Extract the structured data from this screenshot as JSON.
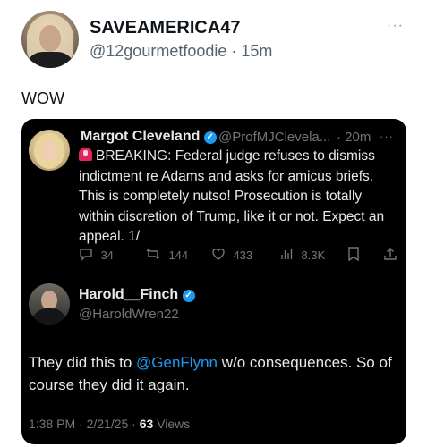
{
  "post": {
    "display_name": "SAVEAMERICA47",
    "handle": "@12gourmetfoodie",
    "separator": " · ",
    "time": "15m",
    "more": "···",
    "text": "WOW"
  },
  "quoted": {
    "reply": {
      "name": "Margot Cleveland",
      "handle": "@ProfMJClevela...",
      "separator": " · ",
      "time": "20m",
      "more": "···",
      "text": "BREAKING: Federal judge refuses to dismiss indictment re Adams and asks for amicus briefs. This is completely nutso! Prosecution is totally within discretion of Trump, like it or not. Expect an appeal. 1/",
      "stats": {
        "replies": "34",
        "reposts": "144",
        "likes": "433",
        "views": "8.3K"
      }
    },
    "main": {
      "name": "Harold__Finch",
      "handle": "@HaroldWren22",
      "text_before": "They did this to ",
      "mention": "@GenFlynn",
      "text_after": " w/o consequences. So of course they did it again.",
      "meta_time": "1:38 PM · 2/21/25 · ",
      "view_count": "63",
      "views_label": " Views"
    }
  },
  "icons": {
    "reply": "comment-icon",
    "repost": "repost-icon",
    "like": "heart-icon",
    "views": "views-bar-icon",
    "bookmark": "bookmark-icon",
    "share": "share-icon",
    "verified": "verified-badge-icon",
    "siren": "siren-emoji-icon"
  },
  "colors": {
    "accent": "#1d9bf0",
    "card_bg": "#000000",
    "muted": "#71767b"
  }
}
